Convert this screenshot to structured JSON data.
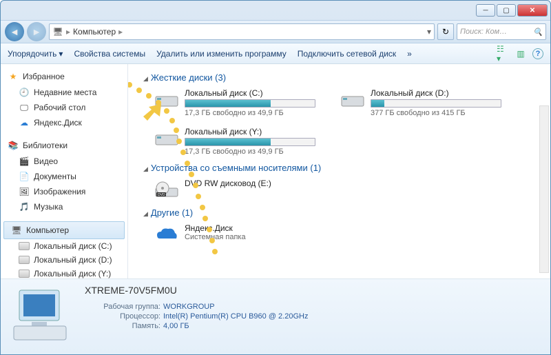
{
  "breadcrumb": {
    "root": "Компьютер"
  },
  "search": {
    "placeholder": "Поиск: Ком…"
  },
  "toolbar": {
    "organize": "Упорядочить",
    "properties": "Свойства системы",
    "uninstall": "Удалить или изменить программу",
    "map_drive": "Подключить сетевой диск",
    "more": "»"
  },
  "sidebar": {
    "favorites": {
      "label": "Избранное",
      "items": [
        "Недавние места",
        "Рабочий стол",
        "Яндекс.Диск"
      ]
    },
    "libraries": {
      "label": "Библиотеки",
      "items": [
        "Видео",
        "Документы",
        "Изображения",
        "Музыка"
      ]
    },
    "computer": {
      "label": "Компьютер",
      "items": [
        "Локальный диск (C:)",
        "Локальный диск (D:)",
        "Локальный диск (Y:)"
      ]
    }
  },
  "groups": {
    "hdd": {
      "label": "Жесткие диски (3)"
    },
    "remov": {
      "label": "Устройства со съемными носителями (1)"
    },
    "other": {
      "label": "Другие (1)"
    }
  },
  "drives": {
    "c": {
      "name": "Локальный диск (C:)",
      "free": "17,3 ГБ свободно из 49,9 ГБ",
      "pct": 66
    },
    "d": {
      "name": "Локальный диск (D:)",
      "free": "377 ГБ свободно из 415 ГБ",
      "pct": 10
    },
    "y": {
      "name": "Локальный диск (Y:)",
      "free": "17,3 ГБ свободно из 49,9 ГБ",
      "pct": 66
    },
    "dvd": {
      "name": "DVD RW дисковод (E:)"
    },
    "yadisk": {
      "name": "Яндекс.Диск",
      "sub": "Системная папка"
    }
  },
  "details": {
    "name": "XTREME-70V5FM0U",
    "rows": {
      "workgroup": {
        "k": "Рабочая группа:",
        "v": "WORKGROUP"
      },
      "cpu": {
        "k": "Процессор:",
        "v": "Intel(R) Pentium(R) CPU B960 @ 2.20GHz"
      },
      "ram": {
        "k": "Память:",
        "v": "4,00 ГБ"
      }
    }
  }
}
